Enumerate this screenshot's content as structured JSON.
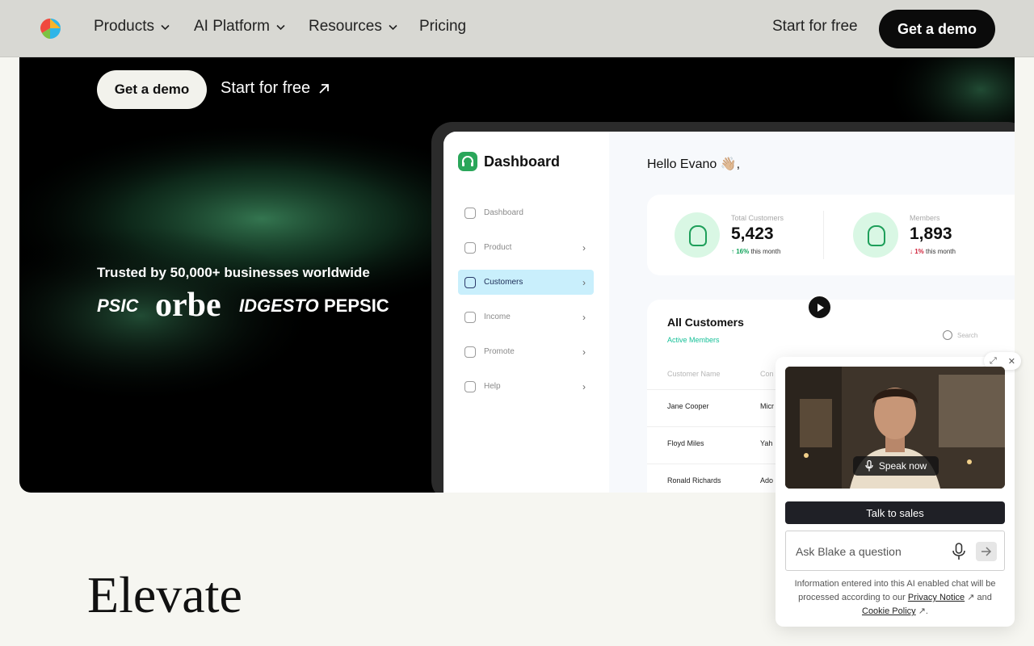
{
  "nav": {
    "items": [
      {
        "label": "Products",
        "has_dropdown": true
      },
      {
        "label": "AI Platform",
        "has_dropdown": true
      },
      {
        "label": "Resources",
        "has_dropdown": true
      },
      {
        "label": "Pricing",
        "has_dropdown": false
      }
    ],
    "start_label": "Start for free",
    "demo_label": "Get a demo"
  },
  "hero": {
    "demo_label": "Get a demo",
    "start_label": "Start for free",
    "trusted_text": "Trusted by 50,000+ businesses worldwide",
    "brands": [
      "PSIC",
      "orbe",
      "IDGESTO",
      "PEPSIC"
    ]
  },
  "dashboard": {
    "title": "Dashboard",
    "greeting": "Hello Evano 👋🏼,",
    "sidebar": [
      {
        "label": "Dashboard",
        "active": false,
        "arrow": ""
      },
      {
        "label": "Product",
        "active": false,
        "arrow": "›"
      },
      {
        "label": "Customers",
        "active": true,
        "arrow": "›"
      },
      {
        "label": "Income",
        "active": false,
        "arrow": "›"
      },
      {
        "label": "Promote",
        "active": false,
        "arrow": "›"
      },
      {
        "label": "Help",
        "active": false,
        "arrow": "›"
      }
    ],
    "stats": [
      {
        "label": "Total Customers",
        "value": "5,423",
        "trend_pct": "16%",
        "trend_text": "this month",
        "direction": "up"
      },
      {
        "label": "Members",
        "value": "1,893",
        "trend_pct": "1%",
        "trend_text": "this month",
        "direction": "down"
      }
    ],
    "customers": {
      "title": "All Customers",
      "subtitle": "Active Members",
      "search_placeholder": "Search",
      "columns": [
        "Customer Name",
        "Con"
      ],
      "rows": [
        [
          "Jane Cooper",
          "Micr"
        ],
        [
          "Floyd Miles",
          "Yah"
        ],
        [
          "Ronald Richards",
          "Ado"
        ]
      ]
    }
  },
  "chat": {
    "speak_label": "Speak now",
    "talk_label": "Talk to sales",
    "ask_placeholder": "Ask Blake a question",
    "disclaimer_pre": "Information entered into this AI enabled chat will be processed according to our",
    "privacy_label": "Privacy Notice",
    "and_text": "and",
    "cookie_label": "Cookie Policy"
  },
  "section": {
    "heading": "Elevate"
  },
  "colors": {
    "accent_green": "#1e9f5a",
    "active_sidebar": "#c9effc",
    "chat_dark": "#1f2026"
  }
}
